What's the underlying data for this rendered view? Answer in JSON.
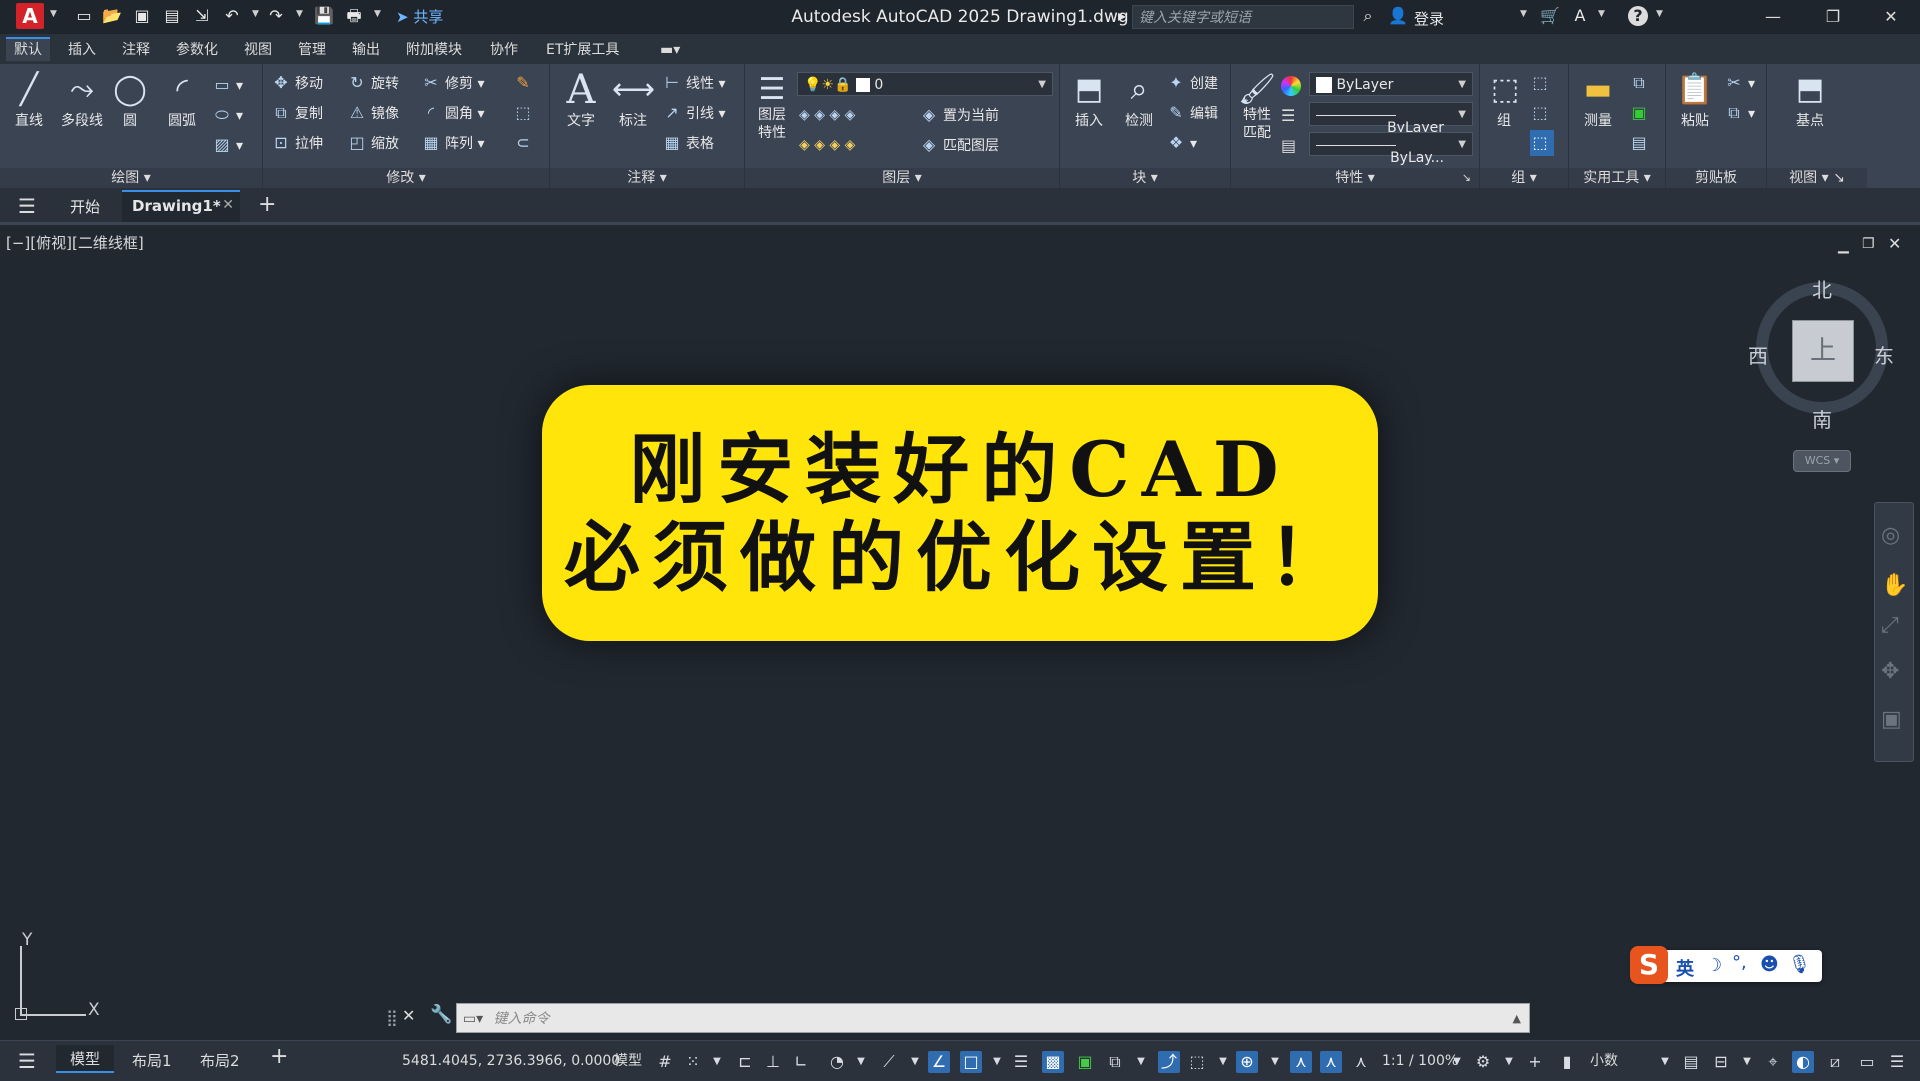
{
  "titlebar": {
    "app_title": "Autodesk AutoCAD 2025    Drawing1.dwg",
    "logo_letter": "A",
    "share_label": "共享",
    "search_placeholder": "键入关键字或短语",
    "login_label": "登录"
  },
  "ribbon_tabs": [
    "默认",
    "插入",
    "注释",
    "参数化",
    "视图",
    "管理",
    "输出",
    "附加模块",
    "协作",
    "ET扩展工具"
  ],
  "ribbon": {
    "draw": {
      "label": "绘图",
      "tools": [
        "直线",
        "多段线",
        "圆",
        "圆弧"
      ]
    },
    "modify": {
      "label": "修改",
      "tools": [
        "移动",
        "旋转",
        "修剪",
        "复制",
        "镜像",
        "圆角",
        "拉伸",
        "缩放",
        "阵列"
      ]
    },
    "annotation": {
      "label": "注释",
      "tools": [
        "文字",
        "标注",
        "线性",
        "引线",
        "表格"
      ]
    },
    "layers": {
      "label": "图层",
      "props_label": "图层\n特性",
      "layer_value": "0",
      "set_current": "置为当前",
      "match_layer": "匹配图层"
    },
    "block": {
      "label": "块",
      "insert": "插入",
      "inspect": "检测",
      "create": "创建",
      "edit": "编辑"
    },
    "properties": {
      "label": "特性",
      "match": "特性\n匹配",
      "color": "ByLayer",
      "linetype": "ByLayer",
      "lineweight": "ByLay..."
    },
    "groups": {
      "label": "组",
      "group": "组"
    },
    "utilities": {
      "label": "实用工具",
      "measure": "测量"
    },
    "clipboard": {
      "label": "剪贴板",
      "paste": "粘贴"
    },
    "view": {
      "label": "视图",
      "base": "基点"
    }
  },
  "doc_tabs": {
    "start": "开始",
    "drawing": "Drawing1*"
  },
  "viewport_label": "[−][俯视][二维线框]",
  "banner": {
    "line1": "刚安装好的CAD",
    "line2": "必须做的优化设置！"
  },
  "viewcube": {
    "north": "北",
    "south": "南",
    "east": "东",
    "west": "西",
    "face": "上",
    "wcs": "WCS"
  },
  "ucs": {
    "x": "X",
    "y": "Y"
  },
  "command": {
    "placeholder": "键入命令"
  },
  "status": {
    "tabs": [
      "模型",
      "布局1",
      "布局2"
    ],
    "coords": "5481.4045, 2736.3966, 0.0000",
    "model": "模型",
    "scale": "1:1 / 100%",
    "units": "小数"
  },
  "ime": {
    "lang": "英"
  }
}
